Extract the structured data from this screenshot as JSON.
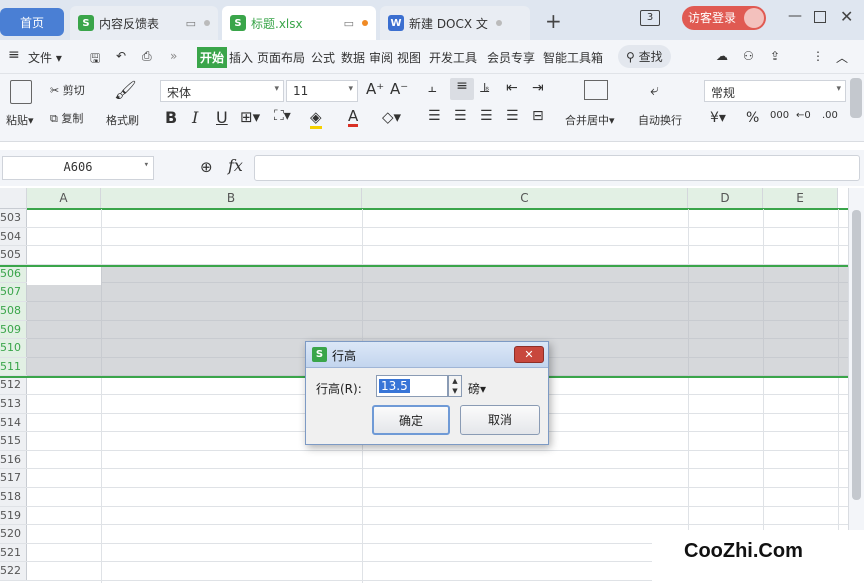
{
  "tabs": {
    "home": "首页",
    "feedback": "内容反馈表",
    "file": "标题.xlsx",
    "docx": "新建 DOCX 文"
  },
  "titlebar": {
    "login": "访客登录",
    "badge": "3"
  },
  "menu": {
    "file": "文件",
    "items": [
      "开始",
      "插入",
      "页面布局",
      "公式",
      "数据",
      "审阅",
      "视图",
      "开发工具",
      "会员专享",
      "智能工具箱"
    ],
    "search": "查找"
  },
  "ribbon": {
    "paste": "粘贴",
    "cut": "剪切",
    "copy": "复制",
    "format_painter": "格式刷",
    "font_name": "宋体",
    "font_size": "11",
    "merge_center": "合并居中",
    "auto_wrap": "自动换行",
    "number_format": "常规"
  },
  "formula": {
    "name_box": "A606",
    "fx": "fx"
  },
  "grid": {
    "columns": [
      "A",
      "B",
      "C",
      "D",
      "E"
    ],
    "rows": [
      "503",
      "504",
      "505",
      "506",
      "507",
      "508",
      "509",
      "510",
      "511",
      "512",
      "513",
      "514",
      "515",
      "516",
      "517",
      "518",
      "519",
      "520",
      "521",
      "522"
    ]
  },
  "dialog": {
    "title": "行高",
    "label": "行高(R):",
    "value": "13.5",
    "unit": "磅",
    "ok": "确定",
    "cancel": "取消"
  },
  "watermark": "CooZhi.Com",
  "colors": {
    "accent_green": "#3aa54a",
    "selection_gray": "#cfd1d4",
    "home_tab": "#4a7fd4"
  }
}
